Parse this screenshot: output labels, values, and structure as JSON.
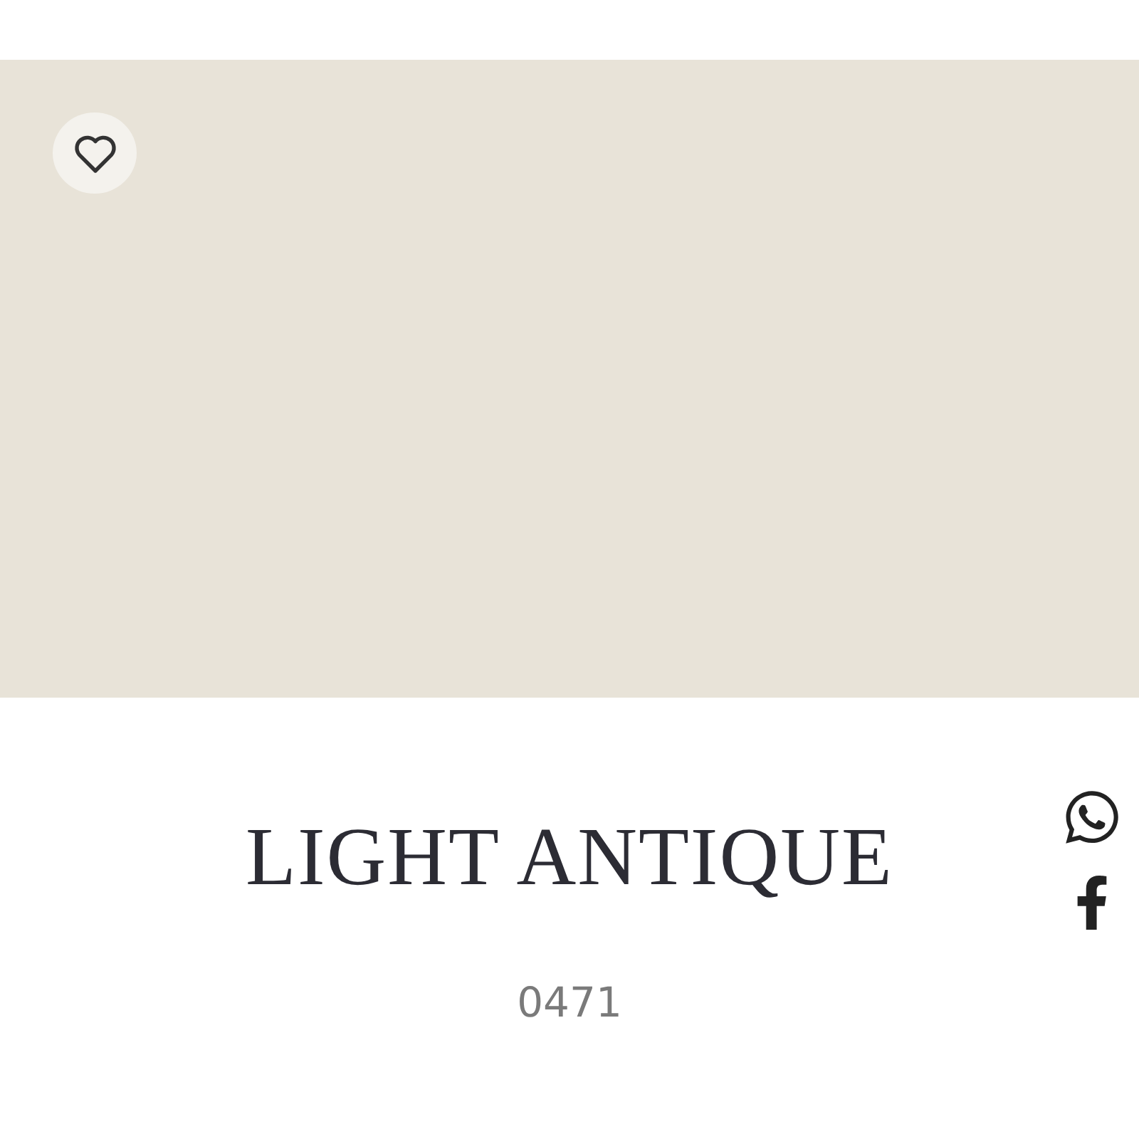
{
  "swatch": {
    "color": "#e8e3d8",
    "favorite": false
  },
  "title": "LIGHT ANTIQUE",
  "code": "0471",
  "share": [
    {
      "kind": "whatsapp"
    },
    {
      "kind": "facebook"
    }
  ]
}
